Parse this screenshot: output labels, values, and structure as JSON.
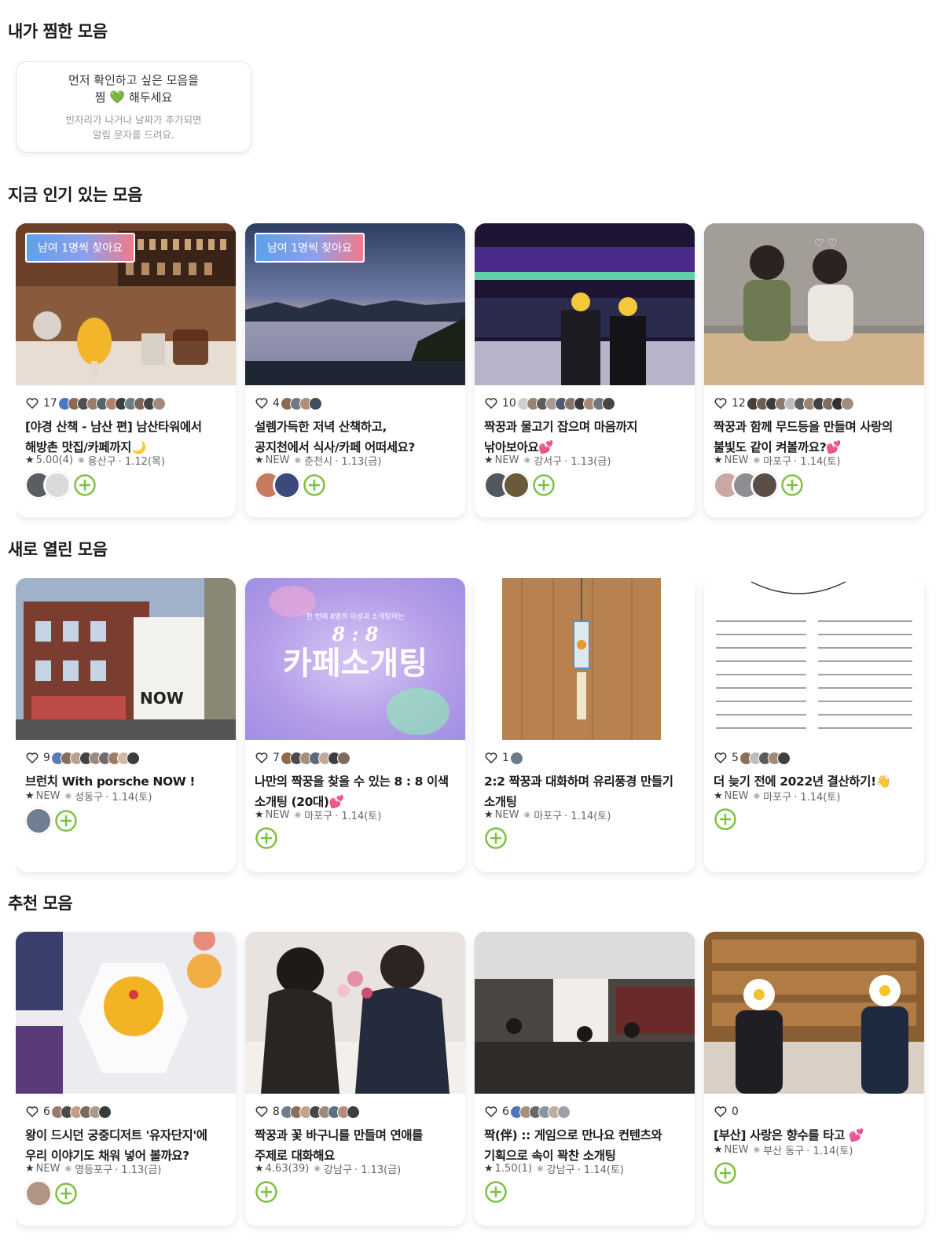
{
  "sections": {
    "liked": "내가 찜한 모음",
    "popular": "지금 인기 있는 모음",
    "new": "새로 열린 모음",
    "recommended": "추천 모음"
  },
  "empty_liked": {
    "line1": "먼저 확인하고 싶은 모음을",
    "line2_pre": "찜",
    "line2_post": "해두세요",
    "heart_icon": "green-heart-icon",
    "sub1": "빈자리가 나거나 날짜가 추가되면",
    "sub2": "알림 문자를 드려요."
  },
  "accent_colors": {
    "plus": "#7cc142",
    "badge_start": "#5fa0ea",
    "badge_end": "#f07b8a"
  },
  "popular": [
    {
      "badge": "남여 1명씩 찾아요",
      "likes": "17",
      "title1": "[야경 산책 - 남산 편] 남산타워에서",
      "title2": "해방촌 맛집/카페까지🌙",
      "rating": "5.00(4)",
      "location": "용산구",
      "date": "1.12(목)"
    },
    {
      "badge": "남여 1명씩 찾아요",
      "likes": "4",
      "title1": "설렘가득한 저녁 산책하고,",
      "title2": "공지천에서 식사/카페 어떠세요?",
      "rating": "NEW",
      "location": "춘천시",
      "date": "1.13(금)"
    },
    {
      "badge": "",
      "likes": "10",
      "title1": "짝꿍과 물고기 잡으며 마음까지",
      "title2": "낚아보아요💕",
      "rating": "NEW",
      "location": "강서구",
      "date": "1.13(금)"
    },
    {
      "badge": "",
      "likes": "12",
      "title1": "짝꿍과 함께 무드등을 만들며 사랑의",
      "title2": "불빛도 같이 켜볼까요?💕",
      "rating": "NEW",
      "location": "마포구",
      "date": "1.14(토)"
    }
  ],
  "new_meetings": [
    {
      "likes": "9",
      "title1": "브런치 With porsche NOW !",
      "title2": "",
      "rating": "NEW",
      "location": "성동구",
      "date": "1.14(토)"
    },
    {
      "likes": "7",
      "title1": "나만의 짝꿍을 찾을 수 있는 8 : 8 이색",
      "title2": "소개팅 (20대)💕",
      "rating": "NEW",
      "location": "마포구",
      "date": "1.14(토)",
      "poster_top": "한 번에 8명의 이성과 소개팅하는",
      "poster_mid": "8 : 8",
      "poster_main": "카페소개팅"
    },
    {
      "likes": "1",
      "title1": "2:2 짝꿍과 대화하며 유리풍경 만들기",
      "title2": "소개팅",
      "rating": "NEW",
      "location": "마포구",
      "date": "1.14(토)"
    },
    {
      "likes": "5",
      "title1": "더 늦기 전에 2022년 결산하기!👋",
      "title2": "",
      "rating": "NEW",
      "location": "마포구",
      "date": "1.14(토)"
    }
  ],
  "recommended": [
    {
      "likes": "6",
      "title1": "왕이 드시던 궁중디저트 '유자단지'에",
      "title2": "우리 이야기도 채워 넣어 볼까요?",
      "rating": "NEW",
      "location": "영등포구",
      "date": "1.13(금)"
    },
    {
      "likes": "8",
      "title1": "짝꿍과 꽃 바구니를 만들며 연애를",
      "title2": "주제로 대화해요",
      "rating": "4.63(39)",
      "location": "강남구",
      "date": "1.13(금)"
    },
    {
      "likes": "6",
      "title1": "짝(伴) :: 게임으로 만나요 컨텐츠와",
      "title2": "기획으로 속이 꽉찬 소개팅",
      "rating": "1.50(1)",
      "location": "강남구",
      "date": "1.14(토)"
    },
    {
      "likes": "0",
      "title1": "[부산] 사랑은 향수를 타고 💕",
      "title2": "",
      "rating": "NEW",
      "location": "부산 동구",
      "date": "1.14(토)"
    }
  ]
}
